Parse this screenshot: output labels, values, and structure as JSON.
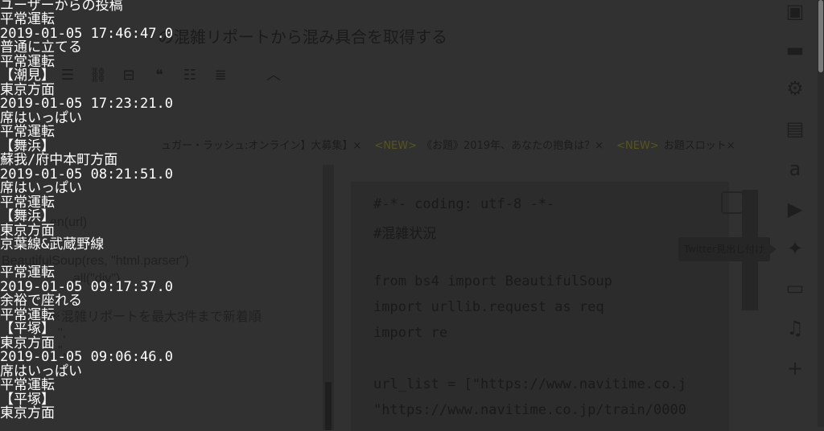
{
  "background_page": {
    "title": "の混雑リポートから混み具合を取得する",
    "toolbar_icons": [
      "list-icon",
      "link-icon",
      "horizontal-rule-icon",
      "quote-icon",
      "bullet-list-icon",
      "numbered-list-icon",
      "chevron-up-icon"
    ],
    "tags": [
      {
        "badge": "",
        "text": "ュガー・ラッシュ:オンライン】大募集】×"
      },
      {
        "badge": "<NEW>",
        "text": "《お題》2019年、あなたの抱負は？×"
      },
      {
        "badge": "<NEW>",
        "text": "お題スロット×"
      }
    ],
    "left_text": [
      "en(url)",
      "BeautifulSoup(res, \"html.parser\")",
      "_all(\"div\")",
      "※混雑リポートを最大3件まで新着順",
      "\",",
      "\","
    ],
    "code": [
      "#-*- coding: utf-8 -*-",
      "#混雑状況",
      "",
      "from bs4 import BeautifulSoup",
      "import urllib.request as req",
      "import re",
      "",
      "url_list = [\"https://www.navitime.co.j",
      "\"https://www.navitime.co.jp/train/0000"
    ],
    "tooltip": "Twitter見出し付け",
    "right_icons": [
      "image-icon",
      "folder-icon",
      "gear-icon",
      "document-icon",
      "amazon-icon",
      "youtube-icon",
      "twitter-icon",
      "tv-icon",
      "music-icon",
      "plus-icon"
    ]
  },
  "terminal_output": [
    "ユーザーからの投稿",
    "平常運転",
    "2019-01-05 17:46:47.0",
    "普通に立てる",
    "平常運転",
    "【潮見】",
    "東京方面",
    "2019-01-05 17:23:21.0",
    "席はいっぱい",
    "平常運転",
    "【舞浜】",
    "蘇我/府中本町方面",
    "2019-01-05 08:21:51.0",
    "席はいっぱい",
    "平常運転",
    "【舞浜】",
    "東京方面",
    "京葉線&武蔵野線",
    "",
    "平常運転",
    "2019-01-05 09:17:37.0",
    "余裕で座れる",
    "平常運転",
    "【平塚】",
    "東京方面",
    "2019-01-05 09:06:46.0",
    "席はいっぱい",
    "平常運転",
    "【平塚】",
    "東京方面"
  ]
}
